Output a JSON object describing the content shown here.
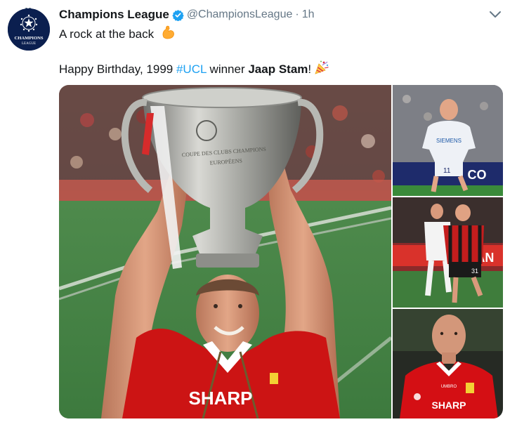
{
  "tweet": {
    "display_name": "Champions League",
    "handle": "@ChampionsLeague",
    "separator": "·",
    "time": "1h",
    "line1": "A rock at the back",
    "line2_prefix": "Happy Birthday, 1999 ",
    "hashtag": "#UCL",
    "line2_middle": " winner ",
    "player_name": "Jaap Stam",
    "line2_suffix": "!"
  },
  "avatar": {
    "logo_line1": "CHAMPIONS",
    "logo_line2": "LEAGUE"
  },
  "photos": {
    "main": {
      "trophy_engraving_line1": "COUPE DES CLUBS CHAMPIONS",
      "trophy_engraving_line2": "EUROPÉENS",
      "shirt_sponsor": "SHARP"
    },
    "side1": {
      "shirt_sponsor": "SIEMENS",
      "shirt_number": "11",
      "board_text": "CO"
    },
    "side2": {
      "shirt_number": "31",
      "board_text": "SPAN"
    },
    "side3": {
      "shirt_sponsor": "SHARP",
      "shirt_brand": "UMBRO"
    }
  },
  "icons": {
    "verified": "verified-badge-icon",
    "chevron": "chevron-down-icon",
    "flex": "flexed-biceps-emoji",
    "party": "party-popper-emoji"
  },
  "colors": {
    "link": "#1da1f2",
    "verified": "#1da1f2",
    "muted": "#657786",
    "text": "#14171a",
    "man_utd_red": "#d40f14"
  }
}
